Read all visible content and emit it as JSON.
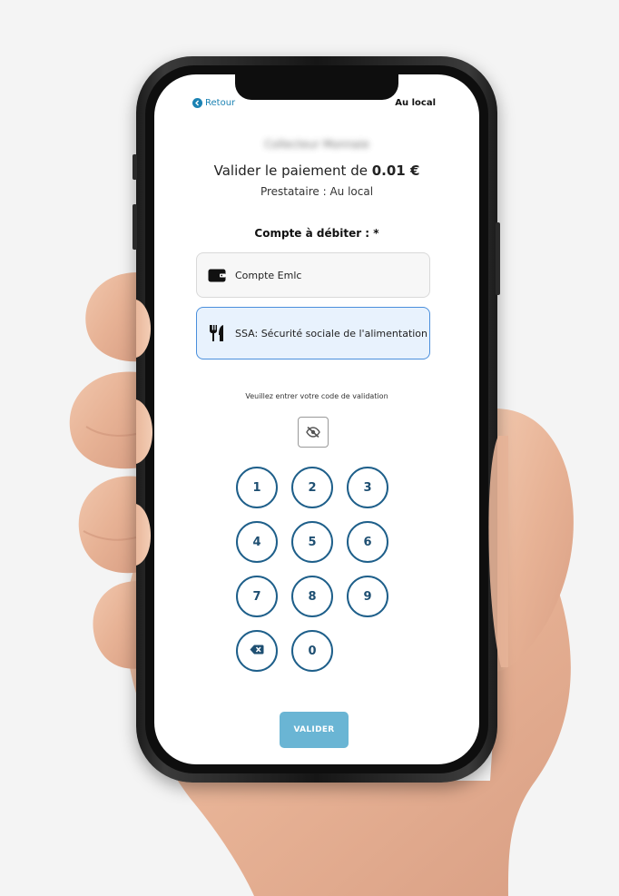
{
  "header": {
    "back_label": "Retour",
    "place_label": "Au local"
  },
  "payment": {
    "blurred_name": "Collecteur Monnaie",
    "title_prefix": "Valider le paiement de ",
    "amount": "0.01 €",
    "provider": "Prestataire : Au local",
    "debit_label": "Compte à débiter : *"
  },
  "accounts": [
    {
      "label": "Compte Emlc",
      "icon": "wallet-icon",
      "selected": false
    },
    {
      "label": "SSA: Sécurité sociale de l'alimentation",
      "icon": "fork-knife-icon",
      "selected": true
    }
  ],
  "pin": {
    "instruction": "Veuillez entrer votre code de validation",
    "visibility_icon": "eye-slash-icon",
    "keys": [
      "1",
      "2",
      "3",
      "4",
      "5",
      "6",
      "7",
      "8",
      "9",
      "0"
    ],
    "backspace_icon": "backspace-icon"
  },
  "actions": {
    "validate_label": "VALIDER"
  },
  "colors": {
    "accent": "#1b82b3",
    "key_border": "#1e5f8a",
    "selected_bg": "#e8f2fd",
    "selected_border": "#4a8fdc",
    "validate_bg": "#6ab5d4"
  }
}
